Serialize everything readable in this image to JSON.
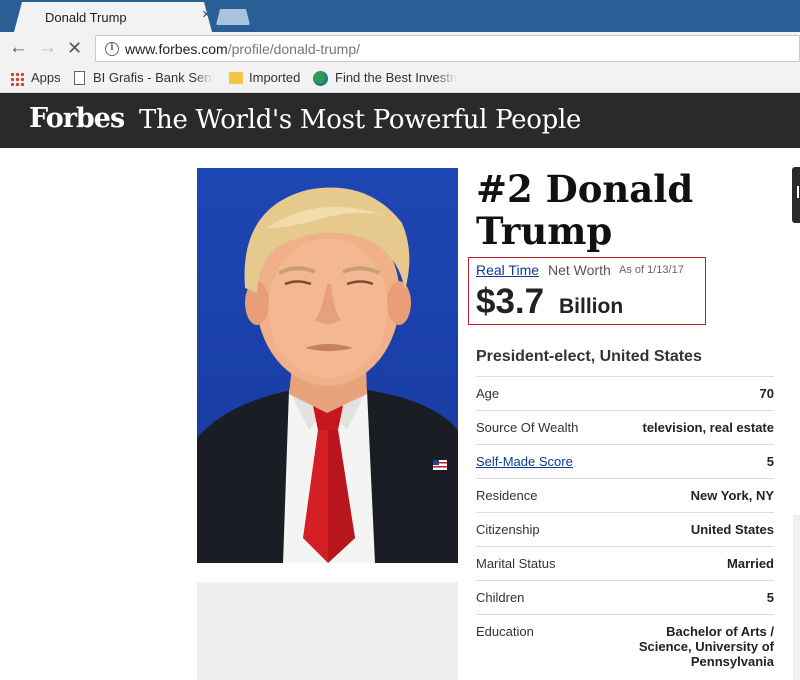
{
  "browser": {
    "tab_title": "Donald Trump",
    "tab_close": "×",
    "url_host": "www.forbes.com",
    "url_path": "/profile/donald-trump/",
    "bookmarks": [
      {
        "label": "Apps"
      },
      {
        "label": "BI Grafis - Bank Sentral"
      },
      {
        "label": "Imported"
      },
      {
        "label": "Find the Best Investment"
      }
    ]
  },
  "header": {
    "logo": "Forbes",
    "title": "The World's Most Powerful People"
  },
  "profile": {
    "name": "#2 Donald Trump",
    "networth": {
      "realtime_label": "Real Time",
      "label": "Net Worth",
      "as_of": "As of 1/13/17",
      "amount": "$3.7",
      "unit": "Billion"
    },
    "position": "President-elect, United States",
    "facts": [
      {
        "label": "Age",
        "value": "70"
      },
      {
        "label": "Source Of Wealth",
        "value": "television, real estate"
      },
      {
        "label": "Self-Made Score",
        "value": "5"
      },
      {
        "label": "Residence",
        "value": "New York, NY"
      },
      {
        "label": "Citizenship",
        "value": "United States"
      },
      {
        "label": "Marital Status",
        "value": "Married"
      },
      {
        "label": "Children",
        "value": "5"
      },
      {
        "label": "Education",
        "value": "Bachelor of Arts / Science, University of Pennsylvania"
      }
    ]
  },
  "colors": {
    "chrome_blue": "#2a5f96",
    "header_bg": "#2a2a2a",
    "highlight_border": "#c0212f",
    "link": "#0b3d91"
  }
}
